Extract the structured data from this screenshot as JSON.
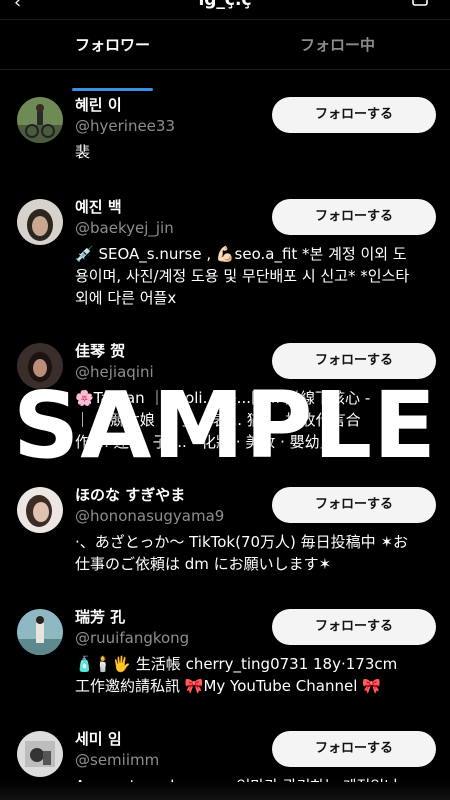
{
  "header": {
    "back_glyph": "‹",
    "title": "ig_ç.ç"
  },
  "tabs": [
    {
      "label": "フォロワー",
      "active": true
    },
    {
      "label": "フォロー中",
      "active": false
    }
  ],
  "accent_color": "#3a8ee6",
  "users": [
    {
      "name": "혜린 이",
      "handle": "@hyerinee33",
      "bio": [
        "裴"
      ],
      "button": "フォローする"
    },
    {
      "name": "예진 백",
      "handle": "@baekyej_jin",
      "bio": [
        "💉 SEOA_s.nurse , 💪🏻seo.a_fit *본 계정 이외 도",
        "용이며, 사진/계정 도용 및 무단배포 시 신고* *인스타",
        "외에 다른 어플x"
      ],
      "button": "フォローする"
    },
    {
      "name": "佳琴 贺",
      "handle": "@hejiaqini",
      "bio": [
        "🌸Taiwan ｜ Taoli... 快...閣... 隊線下核心 -",
        "｜ 電競女娘 ... 了... 表... 猫 ... 招收代言合",
        "作 ... 迷 ... 子 ... · 化妝 · 美妝 · 嬰幼兒"
      ],
      "button": "フォローする"
    },
    {
      "name": "ほのな すぎやま",
      "handle": "@hononasugyama9",
      "bio": [
        "·、あざとっか～ TikTok(70万人) 毎日投稿中 ✶お",
        "仕事のご依頼は dm にお願いします✶"
      ],
      "button": "フォローする"
    },
    {
      "name": "瑞芳 孔",
      "handle": "@ruuifangkong",
      "bio": [
        "🧴🕯️🖐 生活帳 cherry_ting0731 18y·173cm",
        "工作邀約請私訊 🎀My YouTube Channel 🎀"
      ],
      "button": "フォローする"
    },
    {
      "name": "세미 임",
      "handle": "@semiimm",
      "bio": [
        "Account run by mom 엄마가 관리하는 계정입니"
      ],
      "button": "フォローする"
    }
  ],
  "watermark": "SAMPLE"
}
